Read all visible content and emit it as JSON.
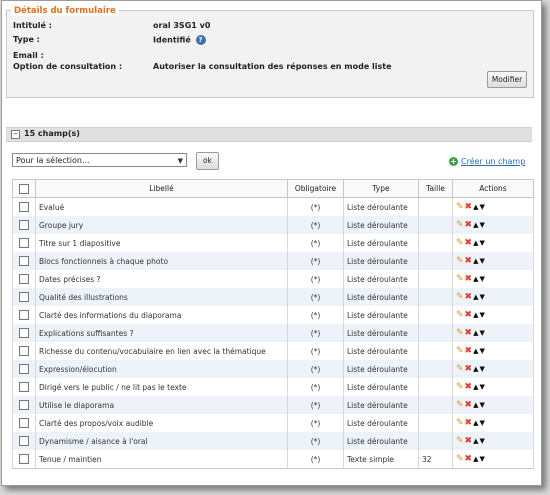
{
  "details": {
    "legend": "Détails du formulaire",
    "labels": {
      "intitule": "Intitulé :",
      "type": "Type :",
      "email": "Email :",
      "option": "Option de consultation :"
    },
    "values": {
      "intitule": "oral 3SG1 v0",
      "type": "Identifié",
      "email": "",
      "option": "Autoriser la consultation des réponses en mode liste"
    },
    "modify_label": "Modifier"
  },
  "fields": {
    "count_label": "15 champ(s)",
    "selection_label": "Pour la sélection...",
    "ok_label": "ok",
    "create_label": "Créer un champ"
  },
  "table": {
    "headers": [
      "",
      "Libellé",
      "Obligatoire",
      "Type",
      "Taille",
      "Actions"
    ],
    "rows": [
      {
        "libelle": "Evalué",
        "obligatoire": "(*)",
        "type": "Liste déroulante",
        "taille": ""
      },
      {
        "libelle": "Groupe jury",
        "obligatoire": "(*)",
        "type": "Liste déroulante",
        "taille": ""
      },
      {
        "libelle": "Titre sur 1 diapositive",
        "obligatoire": "(*)",
        "type": "Liste déroulante",
        "taille": ""
      },
      {
        "libelle": "Blocs fonctionnels à chaque photo",
        "obligatoire": "(*)",
        "type": "Liste déroulante",
        "taille": ""
      },
      {
        "libelle": "Dates précises ?",
        "obligatoire": "(*)",
        "type": "Liste déroulante",
        "taille": ""
      },
      {
        "libelle": "Qualité des illustrations",
        "obligatoire": "(*)",
        "type": "Liste déroulante",
        "taille": ""
      },
      {
        "libelle": "Clarté des informations du diaporama",
        "obligatoire": "(*)",
        "type": "Liste déroulante",
        "taille": ""
      },
      {
        "libelle": "Explications suffisantes ?",
        "obligatoire": "(*)",
        "type": "Liste déroulante",
        "taille": ""
      },
      {
        "libelle": "Richesse du contenu/vocabulaire en lien avec la thématique",
        "obligatoire": "(*)",
        "type": "Liste déroulante",
        "taille": ""
      },
      {
        "libelle": "Expression/élocution",
        "obligatoire": "(*)",
        "type": "Liste déroulante",
        "taille": ""
      },
      {
        "libelle": "Dirigé vers le public / ne lit pas le texte",
        "obligatoire": "(*)",
        "type": "Liste déroulante",
        "taille": ""
      },
      {
        "libelle": "Utilise le diaporama",
        "obligatoire": "(*)",
        "type": "Liste déroulante",
        "taille": ""
      },
      {
        "libelle": "Clarté des propos/voix audible",
        "obligatoire": "(*)",
        "type": "Liste déroulante",
        "taille": ""
      },
      {
        "libelle": "Dynamisme / aisance à l'oral",
        "obligatoire": "(*)",
        "type": "Liste déroulante",
        "taille": ""
      },
      {
        "libelle": "Tenue / maintien",
        "obligatoire": "(*)",
        "type": "Texte simple",
        "taille": "32"
      }
    ]
  },
  "icons": {
    "edit": "pencil-icon",
    "delete": "delete-icon",
    "up": "arrow-up-icon",
    "down": "arrow-down-icon"
  }
}
